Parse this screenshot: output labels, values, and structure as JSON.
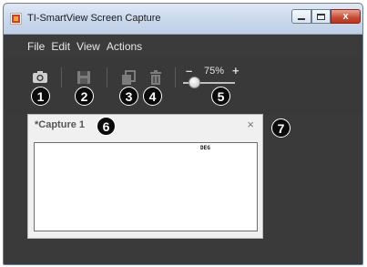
{
  "window": {
    "title": "TI-SmartView Screen Capture",
    "controls": {
      "minimize": "",
      "maximize": "",
      "close": "x"
    }
  },
  "menu": [
    "File",
    "Edit",
    "View",
    "Actions"
  ],
  "toolbar": {
    "icons": [
      "camera-icon",
      "save-icon",
      "copy-icon",
      "trash-icon"
    ],
    "zoom": {
      "minus": "–",
      "value": "75%",
      "plus": "+"
    }
  },
  "callouts": [
    "1",
    "2",
    "3",
    "4",
    "5",
    "6",
    "7"
  ],
  "capture_tab": {
    "modified_marker": "*",
    "title": "Capture 1",
    "close": "×",
    "screen": {
      "mode_indicator": "DEG"
    }
  },
  "colors": {
    "window_bg": "#3a3a3a",
    "titlebar": "#c9d8ec",
    "close_button": "#c84a33",
    "badge": "#0b0b0b"
  }
}
